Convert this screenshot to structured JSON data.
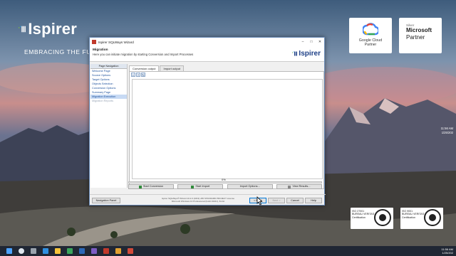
{
  "desktop": {
    "brand": "Ispirer",
    "slogan": "EMBRACING THE FUTUR",
    "google_partner": {
      "line1": "Google Cloud",
      "line2": "Partner"
    },
    "ms_partner": {
      "small": "Silver",
      "line1": "Microsoft",
      "line2": "Partner"
    },
    "cert1": {
      "line1": "ISO 27001",
      "line2": "BUREAU VERITAS",
      "line3": "Certification"
    },
    "cert2": {
      "line1": "ISO 9001",
      "line2": "BUREAU VERITAS",
      "line3": "Certification"
    },
    "clock": {
      "time": "11:56 AM",
      "date": "1/25/202"
    }
  },
  "wizard": {
    "title": "Ispirer SQLWays Wizard",
    "header_title": "Migration",
    "header_subtitle": "Here you can initiate migration by starting Conversion and Import Processes",
    "header_logo": "Ispirer",
    "nav": {
      "header": "Page Navigation",
      "items": [
        {
          "label": "Welcome Page",
          "state": "normal"
        },
        {
          "label": "Source Options",
          "state": "normal"
        },
        {
          "label": "Target Options",
          "state": "normal"
        },
        {
          "label": "Objects Selection",
          "state": "normal"
        },
        {
          "label": "Conversion Options",
          "state": "normal"
        },
        {
          "label": "Summary Page",
          "state": "normal"
        },
        {
          "label": "Migration Execution",
          "state": "active"
        },
        {
          "label": "Migration Reports",
          "state": "disabled"
        }
      ]
    },
    "tabs": [
      {
        "label": "Conversion output",
        "active": true
      },
      {
        "label": "Import output",
        "active": false
      }
    ],
    "progress": {
      "label": "0%",
      "value": 0
    },
    "actions": {
      "start_conversion": "Start Conversion",
      "start_import": "Start Import",
      "import_options": "Import Options...",
      "view_results": "View Results..."
    },
    "footer": {
      "nav_panel": "Navigation Panel",
      "info_line1": "Ispirer SQLWays® Wizard 10.2.0 (2019) x86 STANDARD PROJECT License",
      "info_line2": "Microsoft Windows 10 Professional (build 19041), 64-bit",
      "back": "< Back",
      "next": "Next >",
      "cancel": "Cancel",
      "help": "Help"
    }
  },
  "colors": {
    "accent": "#0078d7",
    "brand": "#1d3f86",
    "progress": "#06b025"
  }
}
